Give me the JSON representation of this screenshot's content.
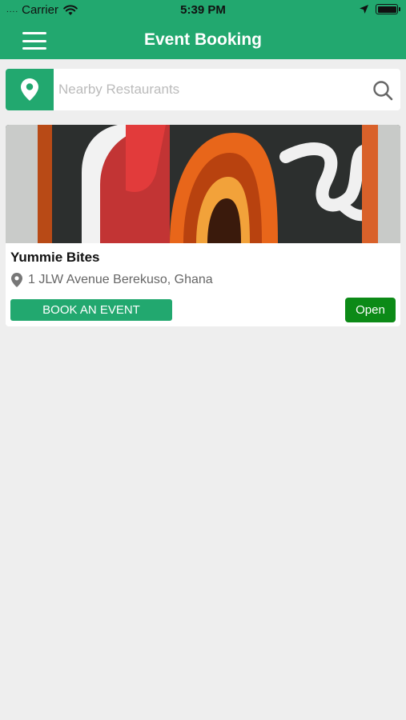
{
  "status_bar": {
    "signal": "....",
    "carrier": "Carrier",
    "time": "5:39 PM"
  },
  "header": {
    "title": "Event Booking",
    "menu_icon": "hamburger-menu-icon"
  },
  "search": {
    "placeholder": "Nearby Restaurants",
    "value": "",
    "location_icon": "map-pin-icon",
    "search_icon": "magnifier-icon"
  },
  "restaurants": [
    {
      "name": "Yummie Bites",
      "address": "1 JLW Avenue Berekuso, Ghana",
      "book_label": "BOOK AN EVENT",
      "status": "Open"
    }
  ],
  "colors": {
    "brand_green": "#22a86f",
    "open_green": "#0c8a17",
    "background": "#eeeeee"
  }
}
